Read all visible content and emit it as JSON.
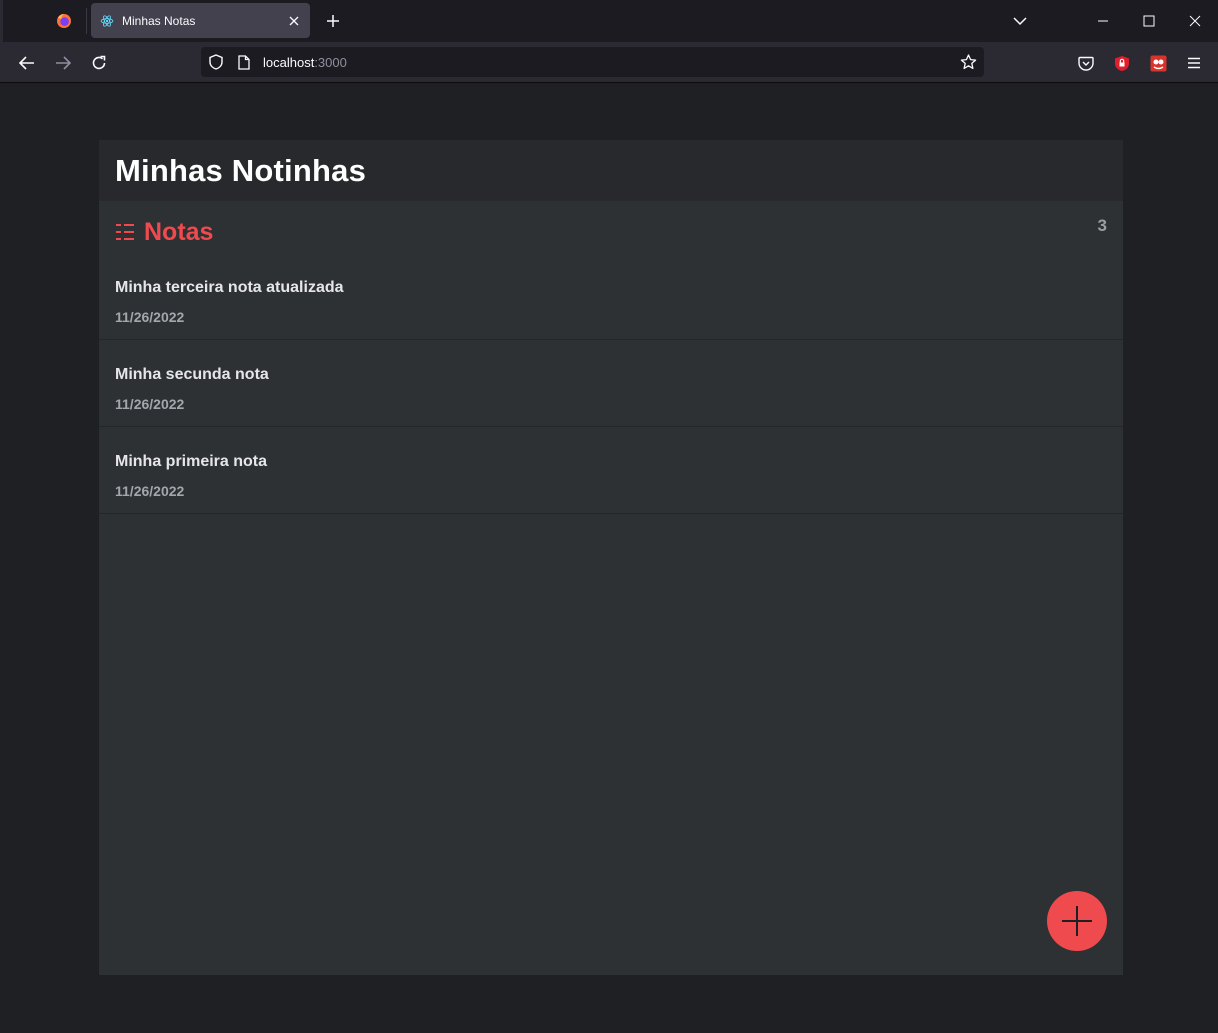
{
  "browser": {
    "tab": {
      "title": "Minhas Notas"
    },
    "url": {
      "host": "localhost",
      "port": ":3000"
    }
  },
  "app": {
    "title": "Minhas Notinhas",
    "section": {
      "title": "Notas",
      "count": "3"
    },
    "notes": [
      {
        "title": "Minha terceira nota atualizada",
        "date": "11/26/2022"
      },
      {
        "title": "Minha secunda nota",
        "date": "11/26/2022"
      },
      {
        "title": "Minha primeira nota",
        "date": "11/26/2022"
      }
    ]
  },
  "colors": {
    "accent": "#ef4a4d",
    "panel": "#2e3134",
    "header": "#27292c",
    "page_bg": "#1f2023"
  },
  "icons": {
    "section": "list-icon",
    "fab": "plus-icon"
  }
}
